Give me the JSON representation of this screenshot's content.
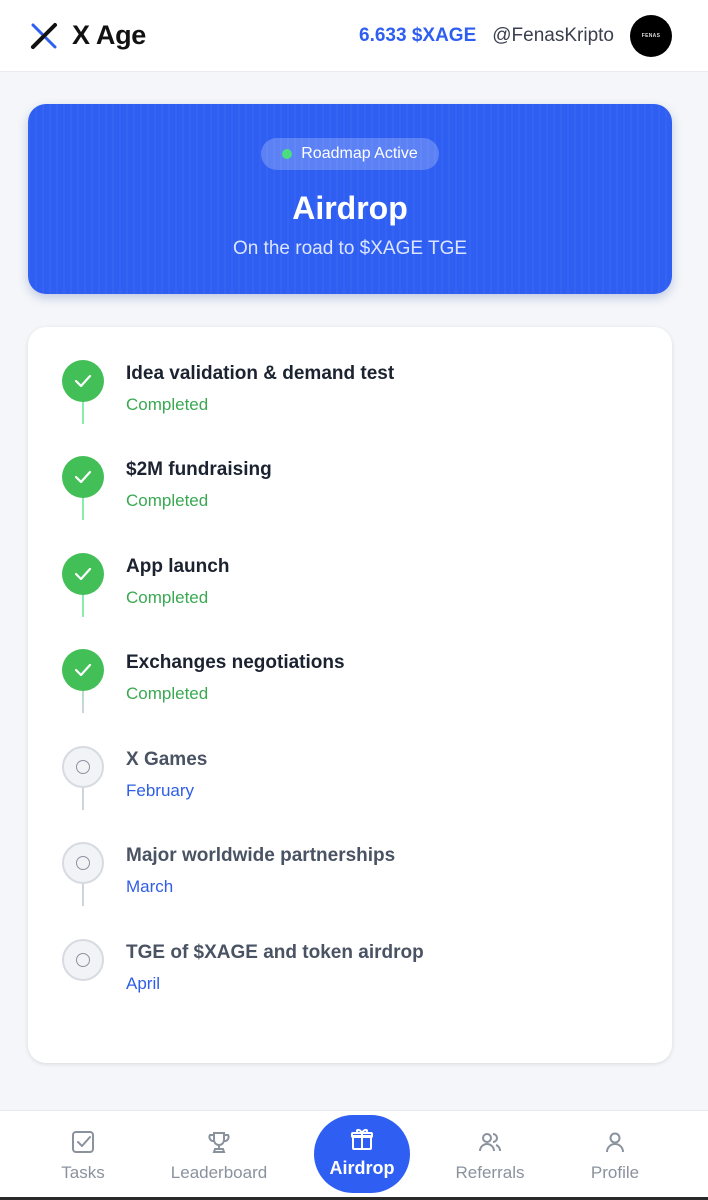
{
  "header": {
    "title": "X Age",
    "balance": "6.633 $XAGE",
    "username": "@FenasKripto",
    "avatar_text": "FENAS"
  },
  "hero": {
    "badge": "Roadmap Active",
    "title": "Airdrop",
    "subtitle": "On the road to $XAGE TGE"
  },
  "roadmap": {
    "steps": [
      {
        "title": "Idea validation & demand test",
        "status": "Completed",
        "state": "done"
      },
      {
        "title": "$2M fundraising",
        "status": "Completed",
        "state": "done"
      },
      {
        "title": "App launch",
        "status": "Completed",
        "state": "done"
      },
      {
        "title": "Exchanges negotiations",
        "status": "Completed",
        "state": "done"
      },
      {
        "title": "X Games",
        "status": "February",
        "state": "pending"
      },
      {
        "title": "Major worldwide partnerships",
        "status": "March",
        "state": "pending"
      },
      {
        "title": "TGE of $XAGE and token airdrop",
        "status": "April",
        "state": "pending"
      }
    ]
  },
  "nav": {
    "tasks": "Tasks",
    "leaderboard": "Leaderboard",
    "airdrop": "Airdrop",
    "referrals": "Referrals",
    "profile": "Profile"
  },
  "icons": {
    "logo": "x-logo-icon",
    "check": "check-icon",
    "pending": "circle-icon",
    "tasks": "checkbox-icon",
    "leaderboard": "trophy-icon",
    "airdrop": "gift-icon",
    "referrals": "users-icon",
    "profile": "user-icon"
  },
  "colors": {
    "accent": "#2f5ef2",
    "done": "#43bf57",
    "pending_text": "#2f5ee6"
  }
}
